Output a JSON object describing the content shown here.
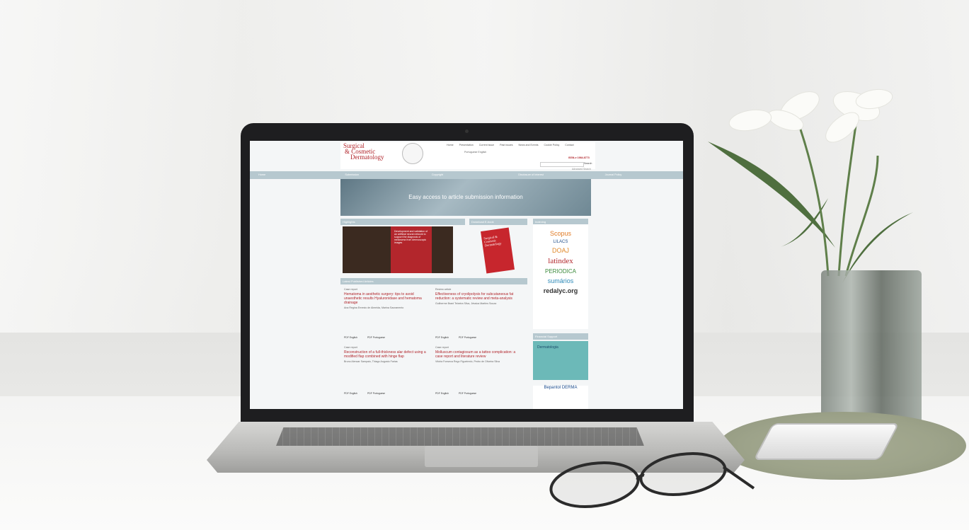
{
  "site": {
    "logo": {
      "line1": "Surgical",
      "line2": "& Cosmetic",
      "line3": "Dermatology"
    },
    "top_nav": [
      "Home",
      "Presentation",
      "Current issue",
      "Past issues",
      "News and Events",
      "Cookie Policy",
      "Contact"
    ],
    "languages": "Portuguese  English",
    "issn": "ISSN-e 1984-8773",
    "search_button": "Search",
    "advanced_search": "Advanced Search",
    "main_nav": [
      "Home",
      "Submission",
      "Copyright",
      "Disclosure of Interest",
      "Journal Policy"
    ],
    "hero_text": "Easy access to article submission information",
    "highlights_title": "Highlights",
    "highlight_text": "Development and validation of an artificial neural network to support the diagnosis of melanoma from dermoscopic images",
    "download_title": "Download E-book",
    "book_title": "Surgical & Cosmetic Dermatology",
    "indexing_title": "Indexing",
    "indexes": [
      "Scopus",
      "LILACS",
      "DOAJ",
      "latindex",
      "PERIODICA",
      "sumários",
      "redalyc.org"
    ],
    "latest_title": "Latest Published Articles",
    "articles": [
      {
        "type": "Case report",
        "title": "Hematoma in aesthetic surgery: tips to avoid unaesthetic results Hyaluronidase and hematoma drainage",
        "authors": "Ana Regina Ernesto de Almeida, Marina Sacramento"
      },
      {
        "type": "Review article",
        "title": "Effectiveness of cryolipolysis for subcutaneous fat reduction: a systematic review and meta-analysis",
        "authors": "Guilherme Brant Teixeira Silva, Jéssica Martins Souza"
      },
      {
        "type": "Case report",
        "title": "Reconstruction of a full-thickness alar defect using a modified flap combined with hinge flap",
        "authors": "Bruno Alencar Sampaio, Thiago Augusto Farias"
      },
      {
        "type": "Case report",
        "title": "Molluscum contagiosum as a tattoo complication: a case report and literature review",
        "authors": "Vitória Fonseca Rego Figueiredo, Pedro de Oliveira Silva"
      }
    ],
    "pdf_en": "PDF English",
    "pdf_pt": "PDF Portuguese",
    "support_title": "Financial Support",
    "support_text": "Dermatologia",
    "bepantol": "Bepantol DERMA"
  },
  "colors": {
    "brand_red": "#b1252b",
    "nav_blue": "#b6c8cf"
  }
}
